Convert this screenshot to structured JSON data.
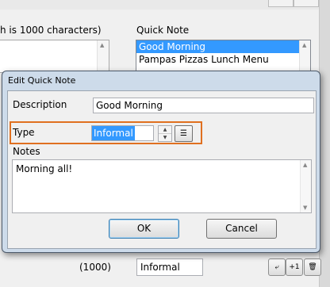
{
  "background": {
    "top_label": "h is 1000 characters)",
    "quick_note_label": "Quick Note",
    "quick_note_items": [
      "Good Morning",
      "Pampas Pizzas Lunch Menu"
    ],
    "char_count": "(1000)",
    "type_value": "Informal",
    "add_icon": "insert-icon",
    "plus_one_label": "+1",
    "delete_icon": "trash-icon"
  },
  "dialog": {
    "title": "Edit Quick Note",
    "description_label": "Description",
    "description_value": "Good Morning",
    "type_label": "Type",
    "type_value": "Informal",
    "notes_label": "Notes",
    "notes_value": "Morning all!",
    "ok_label": "OK",
    "cancel_label": "Cancel"
  },
  "colors": {
    "highlight": "#e07020",
    "selection": "#3399ff"
  }
}
